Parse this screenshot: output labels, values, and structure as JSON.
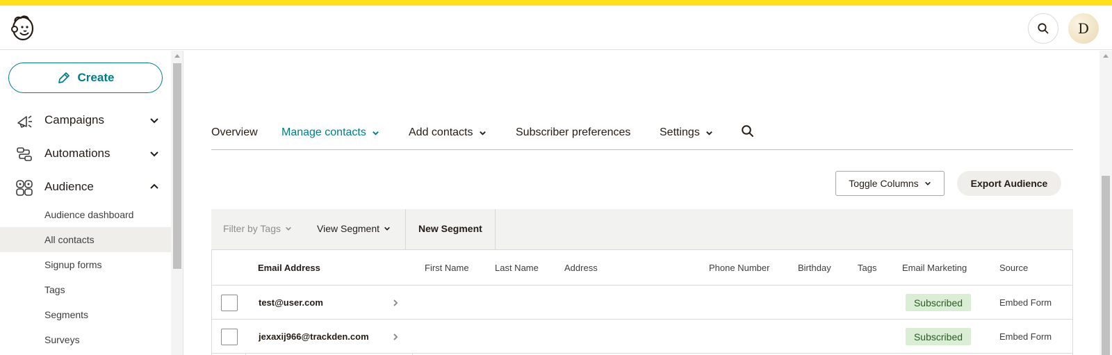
{
  "header": {
    "avatar_initial": "D",
    "accent_color": "#ffe01b"
  },
  "sidebar": {
    "create_label": "Create",
    "nav": [
      {
        "label": "Campaigns",
        "icon": "megaphone-icon",
        "expanded": false
      },
      {
        "label": "Automations",
        "icon": "automation-flow-icon",
        "expanded": false
      },
      {
        "label": "Audience",
        "icon": "audience-icon",
        "expanded": true
      }
    ],
    "audience_items": [
      {
        "label": "Audience dashboard"
      },
      {
        "label": "All contacts",
        "active": true
      },
      {
        "label": "Signup forms"
      },
      {
        "label": "Tags"
      },
      {
        "label": "Segments"
      },
      {
        "label": "Surveys"
      }
    ]
  },
  "tabs": [
    {
      "label": "Overview"
    },
    {
      "label": "Manage contacts"
    },
    {
      "label": "Add contacts"
    },
    {
      "label": "Subscriber preferences"
    },
    {
      "label": "Settings"
    }
  ],
  "actions": {
    "toggle_columns": "Toggle Columns",
    "export_audience": "Export Audience"
  },
  "filters": {
    "filter_by_tags": "Filter by Tags",
    "view_segment": "View Segment",
    "new_segment": "New Segment"
  },
  "table": {
    "columns": [
      "Email Address",
      "First Name",
      "Last Name",
      "Address",
      "Phone Number",
      "Birthday",
      "Tags",
      "Email Marketing",
      "Source"
    ],
    "rows": [
      {
        "email": "test@user.com",
        "email_marketing": "Subscribed",
        "source": "Embed Form"
      },
      {
        "email": "jexaxij966@trackden.com",
        "email_marketing": "Subscribed",
        "source": "Embed Form"
      }
    ]
  },
  "colors": {
    "brand_teal": "#007c89",
    "subscribed_bg": "#d9eed4"
  }
}
